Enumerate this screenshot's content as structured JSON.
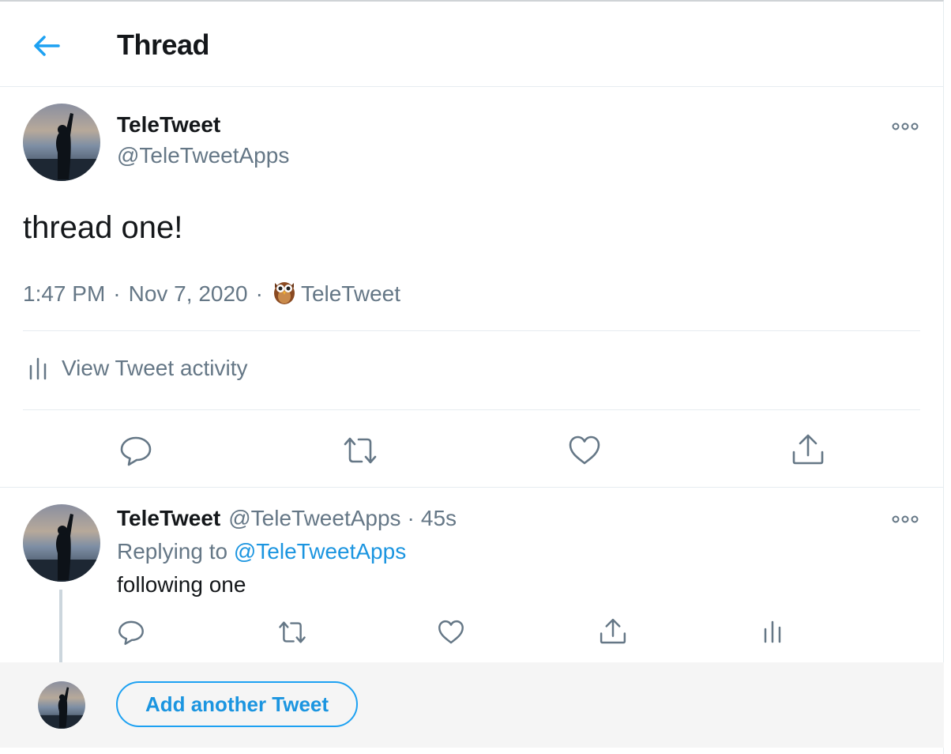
{
  "header": {
    "title": "Thread"
  },
  "main_tweet": {
    "name": "TeleTweet",
    "handle": "@TeleTweetApps",
    "text": "thread one!",
    "time": "1:47 PM",
    "date": "Nov 7, 2020",
    "source": "TeleTweet",
    "activity_label": "View Tweet activity"
  },
  "reply_tweet": {
    "name": "TeleTweet",
    "handle": "@TeleTweetApps",
    "time_ago": "45s",
    "replying_prefix": "Replying to",
    "replying_to": "@TeleTweetApps",
    "text": "following one"
  },
  "composer": {
    "button_label": "Add another Tweet"
  },
  "colors": {
    "accent": "#1da1f2",
    "link": "#1b95e0",
    "muted": "#657786",
    "icon": "#657786"
  },
  "icons": [
    "back-arrow-icon",
    "more-icon",
    "owl-icon",
    "activity-icon",
    "reply-icon",
    "retweet-icon",
    "like-icon",
    "share-icon"
  ]
}
